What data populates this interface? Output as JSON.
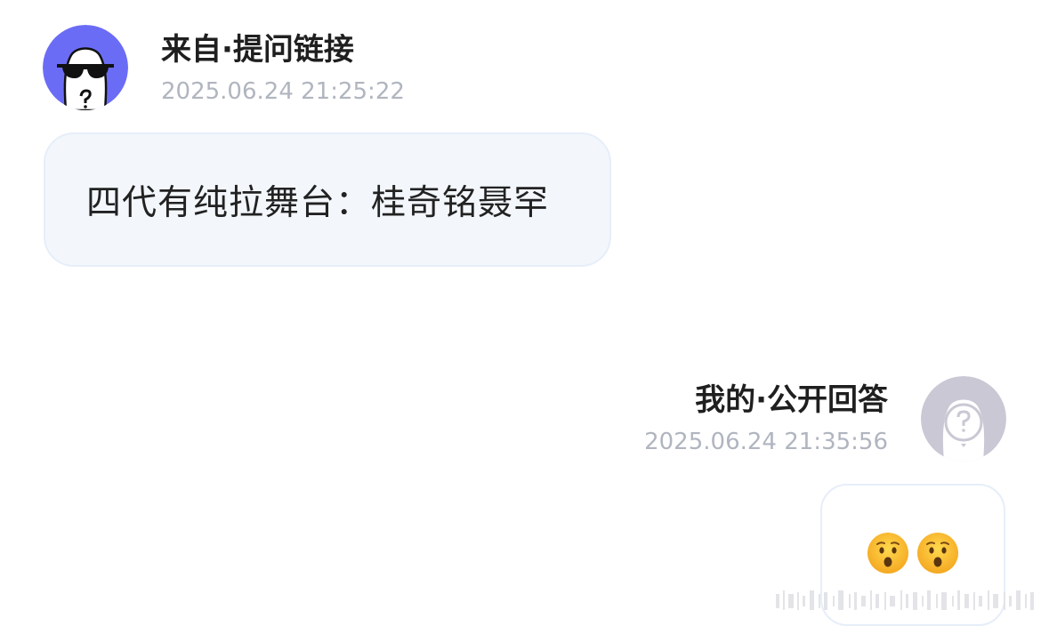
{
  "question": {
    "sender_label": "来自·提问链接",
    "timestamp": "2025.06.24 21:25:22",
    "avatar_icon": "anonymous-sunglasses-avatar-icon",
    "message": "四代有纯拉舞台：桂奇铭聂罕"
  },
  "answer": {
    "sender_label": "我的·公开回答",
    "timestamp": "2025.06.24 21:35:56",
    "avatar_icon": "anonymous-question-avatar-icon",
    "emojis": [
      "hushed-face-icon",
      "hushed-face-icon"
    ]
  },
  "colors": {
    "avatar_question_bg": "#6b6cf6",
    "avatar_answer_bg": "#c9c8d4",
    "bubble_bg": "#f3f7fc",
    "timestamp": "#b0b5bf"
  }
}
